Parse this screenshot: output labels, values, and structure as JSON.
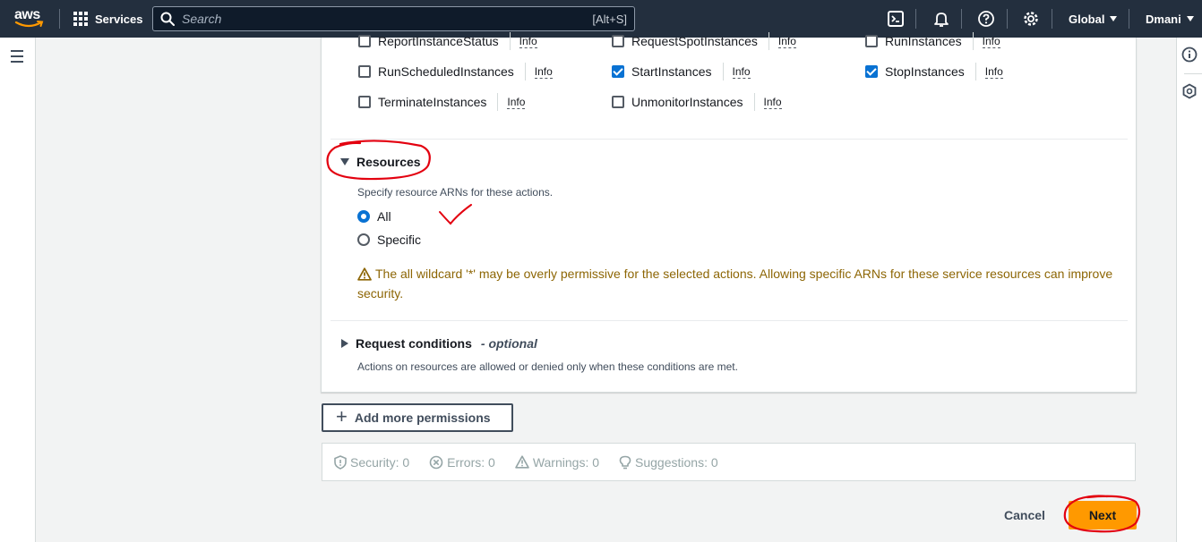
{
  "topnav": {
    "logo_text": "aws",
    "services_label": "Services",
    "search_placeholder": "Search",
    "search_shortcut": "[Alt+S]",
    "region_label": "Global",
    "user_label": "Dmani"
  },
  "actions": [
    {
      "label": "ReportInstanceStatus",
      "checked": false
    },
    {
      "label": "RequestSpotInstances",
      "checked": false
    },
    {
      "label": "RunInstances",
      "checked": false
    },
    {
      "label": "RunScheduledInstances",
      "checked": false
    },
    {
      "label": "StartInstances",
      "checked": true
    },
    {
      "label": "StopInstances",
      "checked": true
    },
    {
      "label": "TerminateInstances",
      "checked": false
    },
    {
      "label": "UnmonitorInstances",
      "checked": false
    }
  ],
  "info_label": "Info",
  "resources": {
    "title": "Resources",
    "description": "Specify resource ARNs for these actions.",
    "options": [
      {
        "label": "All",
        "selected": true
      },
      {
        "label": "Specific",
        "selected": false
      }
    ],
    "warning": "The all wildcard '*' may be overly permissive for the selected actions. Allowing specific ARNs for these service resources can improve security."
  },
  "conditions": {
    "title": "Request conditions",
    "optional": "- optional",
    "description": "Actions on resources are allowed or denied only when these conditions are met."
  },
  "add_more_label": "Add more permissions",
  "summary": {
    "security": "Security: 0",
    "errors": "Errors: 0",
    "warnings": "Warnings: 0",
    "suggestions": "Suggestions: 0"
  },
  "footer": {
    "cancel_label": "Cancel",
    "next_label": "Next"
  },
  "colors": {
    "nav_bg": "#232f3e",
    "accent_blue": "#0972d3",
    "primary_orange": "#ff9900",
    "warning_text": "#8d6605",
    "annotation_red": "#e3000f"
  }
}
